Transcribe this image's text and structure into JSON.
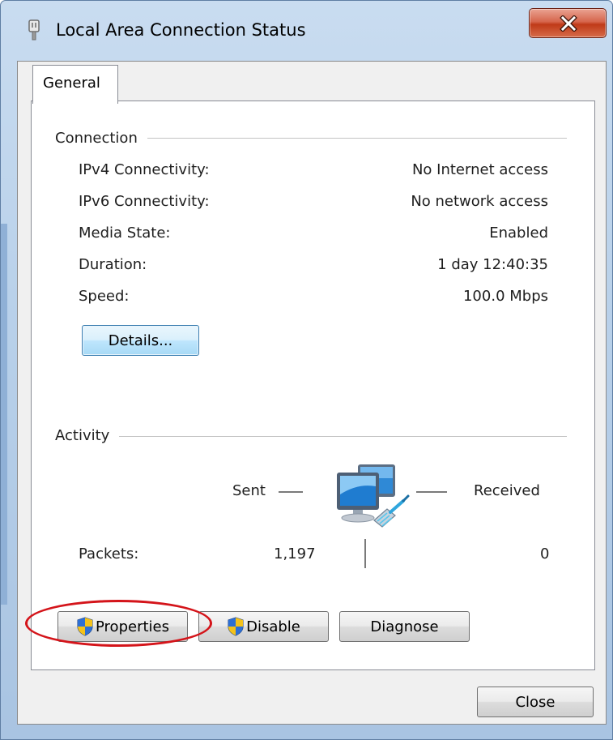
{
  "window": {
    "title": "Local Area Connection Status",
    "title_icon": "network-adapter-icon",
    "close_icon": "close-icon"
  },
  "tabs": [
    {
      "label": "General",
      "selected": true
    }
  ],
  "connection": {
    "group_title": "Connection",
    "rows": [
      {
        "label": "IPv4 Connectivity:",
        "value": "No Internet access"
      },
      {
        "label": "IPv6 Connectivity:",
        "value": "No network access"
      },
      {
        "label": "Media State:",
        "value": "Enabled"
      },
      {
        "label": "Duration:",
        "value": "1 day 12:40:35"
      },
      {
        "label": "Speed:",
        "value": "100.0 Mbps"
      }
    ],
    "details_button": "Details..."
  },
  "activity": {
    "group_title": "Activity",
    "sent_label": "Sent",
    "received_label": "Received",
    "icon": "network-computers-icon",
    "packets_label": "Packets:",
    "packets_sent": "1,197",
    "packets_received": "0"
  },
  "actions": {
    "properties": "Properties",
    "disable": "Disable",
    "diagnose": "Diagnose",
    "shield_icon": "uac-shield-icon"
  },
  "footer": {
    "close": "Close"
  },
  "annotation": {
    "color": "#d4141a",
    "target": "Properties"
  }
}
